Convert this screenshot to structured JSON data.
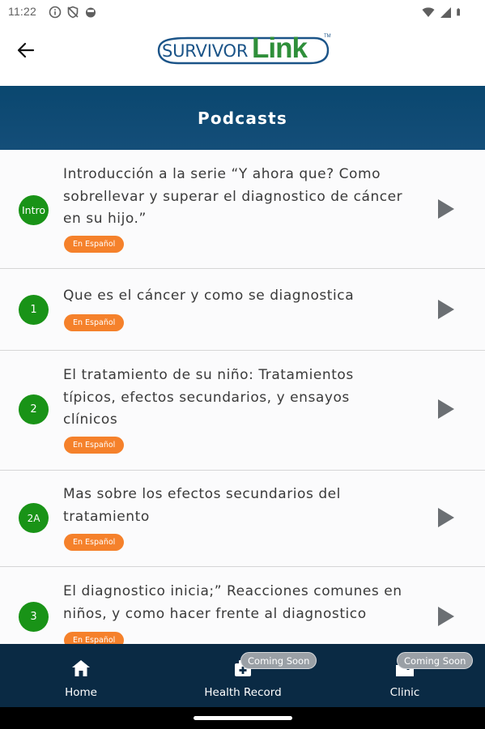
{
  "status_bar": {
    "time": "11:22",
    "left_icons": [
      "info-circle-icon",
      "shield-off-icon",
      "face-icon"
    ],
    "right_icons": [
      "wifi-icon",
      "signal-icon",
      "battery-icon"
    ]
  },
  "header": {
    "logo_text_survivor": "SURVIVOR",
    "logo_text_link": "Link",
    "logo_tm": "TM",
    "back_icon": "arrow-left-icon"
  },
  "page": {
    "title": "Podcasts"
  },
  "colors": {
    "banner": "#0a476f",
    "episode_circle": "#199317",
    "badge": "#f5812b",
    "bottom_nav": "#0a2a44",
    "play_icon": "#6b6f73"
  },
  "podcasts": [
    {
      "number": "Intro",
      "title_lines": [
        "Introducción a la serie “Y ahora que? Como",
        "sobrellevar y superar el diagnostico de cáncer",
        "en su hijo.”"
      ],
      "badge": "En Español"
    },
    {
      "number": "1",
      "title_lines": [
        "Que es el cáncer y como se diagnostica"
      ],
      "badge": "En Español"
    },
    {
      "number": "2",
      "title_lines": [
        "El tratamiento de su niño: Tratamientos",
        "típicos, efectos secundarios, y ensayos",
        "clínicos"
      ],
      "badge": "En Español"
    },
    {
      "number": "2A",
      "title_lines": [
        "Mas sobre los efectos secundarios del",
        "tratamiento"
      ],
      "badge": "En Español"
    },
    {
      "number": "3",
      "title_lines": [
        "El diagnostico inicia;” Reacciones comunes en",
        "niños, y como hacer frente al diagnostico"
      ],
      "badge": "En Español"
    }
  ],
  "bottom_nav": {
    "items": [
      {
        "label": "Home",
        "icon": "home-icon",
        "badge": ""
      },
      {
        "label": "Health Record",
        "icon": "medical-folder-icon",
        "badge": "Coming Soon"
      },
      {
        "label": "Clinic",
        "icon": "hospital-icon",
        "badge": "Coming Soon"
      }
    ]
  }
}
